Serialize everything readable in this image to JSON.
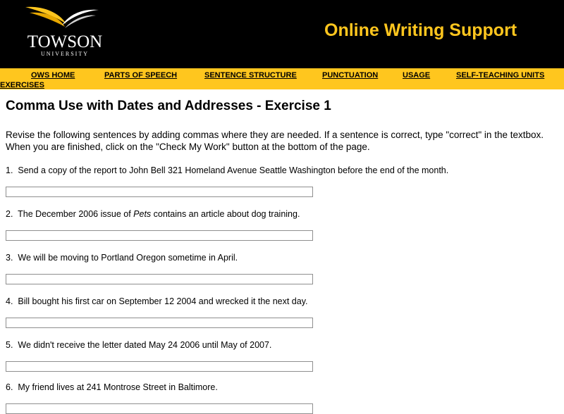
{
  "header": {
    "logo_word": "TOWSON",
    "logo_sub": "UNIVERSITY",
    "site_title": "Online Writing Support"
  },
  "nav": {
    "items": [
      {
        "label": "OWS HOME"
      },
      {
        "label": "PARTS OF SPEECH"
      },
      {
        "label": "SENTENCE STRUCTURE"
      },
      {
        "label": "PUNCTUATION"
      },
      {
        "label": "USAGE"
      },
      {
        "label": "SELF-TEACHING UNITS"
      },
      {
        "label": "EXERCISES"
      }
    ]
  },
  "page": {
    "heading": "Comma Use with Dates and Addresses - Exercise 1",
    "intro": "Revise the following sentences by adding commas where they are needed. If a sentence is correct, type \"correct\" in the textbox. When you are finished, click on the \"Check My Work\" button at the bottom of the page."
  },
  "questions": [
    {
      "number": "1.",
      "text": "Send a copy of the report to John Bell 321 Homeland Avenue Seattle Washington before the end of the month.",
      "answer": ""
    },
    {
      "number": "2.",
      "text_before": "The December 2006 issue of ",
      "italic": "Pets",
      "text_after": " contains an article about dog training.",
      "answer": ""
    },
    {
      "number": "3.",
      "text": "We will be moving to Portland Oregon sometime in April.",
      "answer": ""
    },
    {
      "number": "4.",
      "text": "Bill bought his first car on September 12 2004 and wrecked it the next day.",
      "answer": ""
    },
    {
      "number": "5.",
      "text": "We didn't receive the letter dated May 24 2006 until May of 2007.",
      "answer": ""
    },
    {
      "number": "6.",
      "text": "My friend lives at 241 Montrose Street in Baltimore.",
      "answer": ""
    }
  ]
}
